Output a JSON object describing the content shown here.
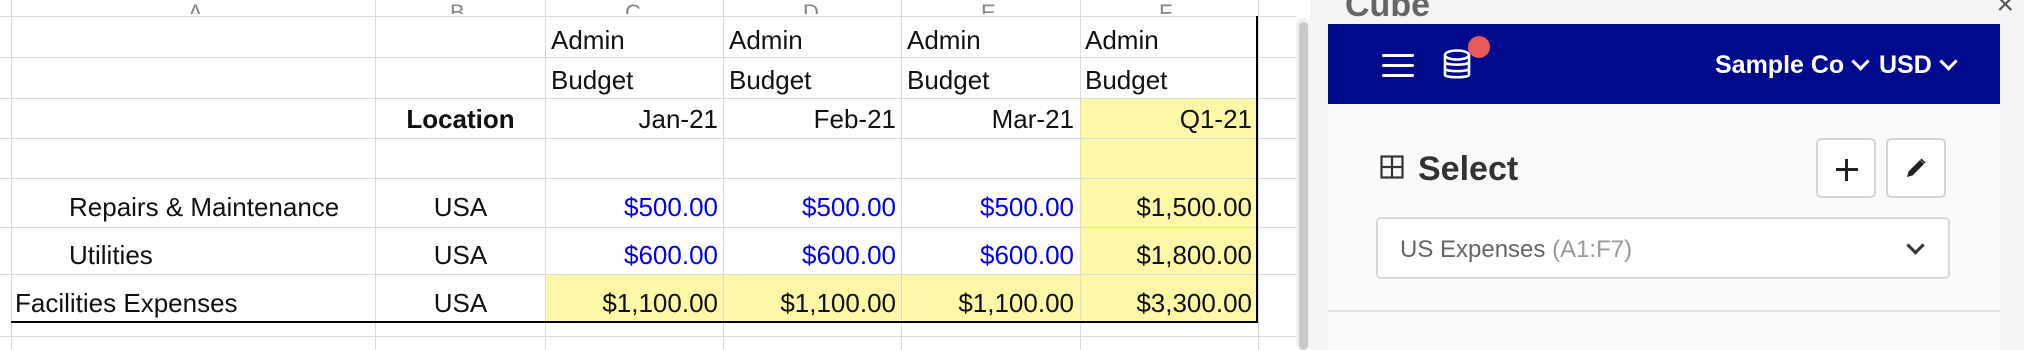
{
  "sheet": {
    "column_headers": [
      "A",
      "B",
      "C",
      "D",
      "E",
      "F"
    ],
    "header_rows": {
      "row1": [
        "Admin",
        "Admin",
        "Admin",
        "Admin"
      ],
      "row2": [
        "Budget",
        "Budget",
        "Budget",
        "Budget"
      ],
      "location_label": "Location",
      "periods": [
        "Jan-21",
        "Feb-21",
        "Mar-21",
        "Q1-21"
      ]
    },
    "rows": [
      {
        "label": "Repairs & Maintenance",
        "location": "USA",
        "values": [
          "$500.00",
          "$500.00",
          "$500.00"
        ],
        "total": "$1,500.00"
      },
      {
        "label": "Utilities",
        "location": "USA",
        "values": [
          "$600.00",
          "$600.00",
          "$600.00"
        ],
        "total": "$1,800.00"
      },
      {
        "label": "Facilities Expenses",
        "location": "USA",
        "values": [
          "$1,100.00",
          "$1,100.00",
          "$1,100.00"
        ],
        "total": "$3,300.00"
      }
    ]
  },
  "panel": {
    "title": "Cube",
    "close_glyph": "×",
    "company": "Sample Co",
    "currency": "USD",
    "icons": {
      "menu": "hamburger-icon",
      "database": "database-icon",
      "grid": "grid-icon",
      "add": "plus-icon",
      "edit": "pencil-icon"
    },
    "select_title": "Select",
    "dataset_name": "US Expenses",
    "dataset_range": "(A1:F7)"
  },
  "colors": {
    "topbar": "#000a8c",
    "highlight": "#fcf8a8",
    "input_blue": "#0000ee",
    "notification": "#e85a5a"
  }
}
